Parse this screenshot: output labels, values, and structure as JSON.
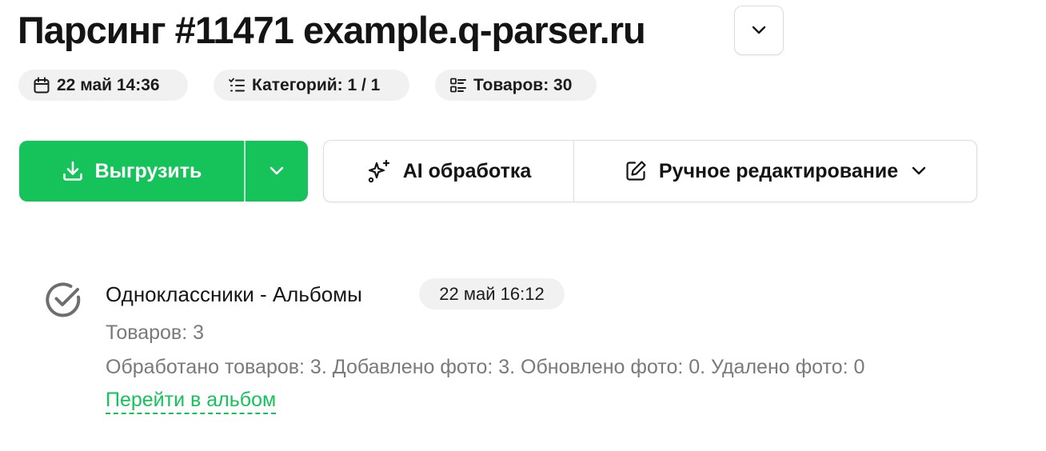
{
  "header": {
    "title": "Парсинг #11471 example.q-parser.ru"
  },
  "meta": {
    "date": "22 май 14:36",
    "categories": "Категорий: 1 / 1",
    "goods": "Товаров: 30"
  },
  "actions": {
    "export_label": "Выгрузить",
    "ai_label": "AI обработка",
    "manual_label": "Ручное редактирование"
  },
  "log": {
    "title": "Одноклассники - Альбомы",
    "time": "22 май 16:12",
    "goods_count": "Товаров: 3",
    "stats": "Обработано товаров: 3. Добавлено фото: 3. Обновлено фото: 0. Удалено фото: 0",
    "link": "Перейти в альбом"
  },
  "colors": {
    "accent": "#16c35b",
    "chip_bg": "#f1f1f1",
    "muted_text": "#7a7a7a"
  },
  "icons": {
    "title_toggle": "chevron-down-icon",
    "date": "calendar-icon",
    "categories": "list-icon",
    "goods": "grid-list-icon",
    "export": "download-icon",
    "export_dropdown": "chevron-down-icon",
    "ai": "sparkles-icon",
    "manual": "edit-icon",
    "manual_dropdown": "chevron-down-icon",
    "status": "check-circle-icon"
  }
}
